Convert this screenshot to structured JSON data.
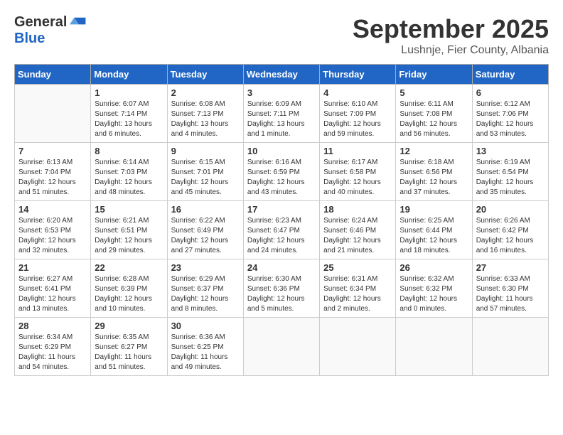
{
  "logo": {
    "general": "General",
    "blue": "Blue"
  },
  "header": {
    "month": "September 2025",
    "location": "Lushnje, Fier County, Albania"
  },
  "weekdays": [
    "Sunday",
    "Monday",
    "Tuesday",
    "Wednesday",
    "Thursday",
    "Friday",
    "Saturday"
  ],
  "weeks": [
    [
      {
        "day": "",
        "info": ""
      },
      {
        "day": "1",
        "info": "Sunrise: 6:07 AM\nSunset: 7:14 PM\nDaylight: 13 hours\nand 6 minutes."
      },
      {
        "day": "2",
        "info": "Sunrise: 6:08 AM\nSunset: 7:13 PM\nDaylight: 13 hours\nand 4 minutes."
      },
      {
        "day": "3",
        "info": "Sunrise: 6:09 AM\nSunset: 7:11 PM\nDaylight: 13 hours\nand 1 minute."
      },
      {
        "day": "4",
        "info": "Sunrise: 6:10 AM\nSunset: 7:09 PM\nDaylight: 12 hours\nand 59 minutes."
      },
      {
        "day": "5",
        "info": "Sunrise: 6:11 AM\nSunset: 7:08 PM\nDaylight: 12 hours\nand 56 minutes."
      },
      {
        "day": "6",
        "info": "Sunrise: 6:12 AM\nSunset: 7:06 PM\nDaylight: 12 hours\nand 53 minutes."
      }
    ],
    [
      {
        "day": "7",
        "info": "Sunrise: 6:13 AM\nSunset: 7:04 PM\nDaylight: 12 hours\nand 51 minutes."
      },
      {
        "day": "8",
        "info": "Sunrise: 6:14 AM\nSunset: 7:03 PM\nDaylight: 12 hours\nand 48 minutes."
      },
      {
        "day": "9",
        "info": "Sunrise: 6:15 AM\nSunset: 7:01 PM\nDaylight: 12 hours\nand 45 minutes."
      },
      {
        "day": "10",
        "info": "Sunrise: 6:16 AM\nSunset: 6:59 PM\nDaylight: 12 hours\nand 43 minutes."
      },
      {
        "day": "11",
        "info": "Sunrise: 6:17 AM\nSunset: 6:58 PM\nDaylight: 12 hours\nand 40 minutes."
      },
      {
        "day": "12",
        "info": "Sunrise: 6:18 AM\nSunset: 6:56 PM\nDaylight: 12 hours\nand 37 minutes."
      },
      {
        "day": "13",
        "info": "Sunrise: 6:19 AM\nSunset: 6:54 PM\nDaylight: 12 hours\nand 35 minutes."
      }
    ],
    [
      {
        "day": "14",
        "info": "Sunrise: 6:20 AM\nSunset: 6:53 PM\nDaylight: 12 hours\nand 32 minutes."
      },
      {
        "day": "15",
        "info": "Sunrise: 6:21 AM\nSunset: 6:51 PM\nDaylight: 12 hours\nand 29 minutes."
      },
      {
        "day": "16",
        "info": "Sunrise: 6:22 AM\nSunset: 6:49 PM\nDaylight: 12 hours\nand 27 minutes."
      },
      {
        "day": "17",
        "info": "Sunrise: 6:23 AM\nSunset: 6:47 PM\nDaylight: 12 hours\nand 24 minutes."
      },
      {
        "day": "18",
        "info": "Sunrise: 6:24 AM\nSunset: 6:46 PM\nDaylight: 12 hours\nand 21 minutes."
      },
      {
        "day": "19",
        "info": "Sunrise: 6:25 AM\nSunset: 6:44 PM\nDaylight: 12 hours\nand 18 minutes."
      },
      {
        "day": "20",
        "info": "Sunrise: 6:26 AM\nSunset: 6:42 PM\nDaylight: 12 hours\nand 16 minutes."
      }
    ],
    [
      {
        "day": "21",
        "info": "Sunrise: 6:27 AM\nSunset: 6:41 PM\nDaylight: 12 hours\nand 13 minutes."
      },
      {
        "day": "22",
        "info": "Sunrise: 6:28 AM\nSunset: 6:39 PM\nDaylight: 12 hours\nand 10 minutes."
      },
      {
        "day": "23",
        "info": "Sunrise: 6:29 AM\nSunset: 6:37 PM\nDaylight: 12 hours\nand 8 minutes."
      },
      {
        "day": "24",
        "info": "Sunrise: 6:30 AM\nSunset: 6:36 PM\nDaylight: 12 hours\nand 5 minutes."
      },
      {
        "day": "25",
        "info": "Sunrise: 6:31 AM\nSunset: 6:34 PM\nDaylight: 12 hours\nand 2 minutes."
      },
      {
        "day": "26",
        "info": "Sunrise: 6:32 AM\nSunset: 6:32 PM\nDaylight: 12 hours\nand 0 minutes."
      },
      {
        "day": "27",
        "info": "Sunrise: 6:33 AM\nSunset: 6:30 PM\nDaylight: 11 hours\nand 57 minutes."
      }
    ],
    [
      {
        "day": "28",
        "info": "Sunrise: 6:34 AM\nSunset: 6:29 PM\nDaylight: 11 hours\nand 54 minutes."
      },
      {
        "day": "29",
        "info": "Sunrise: 6:35 AM\nSunset: 6:27 PM\nDaylight: 11 hours\nand 51 minutes."
      },
      {
        "day": "30",
        "info": "Sunrise: 6:36 AM\nSunset: 6:25 PM\nDaylight: 11 hours\nand 49 minutes."
      },
      {
        "day": "",
        "info": ""
      },
      {
        "day": "",
        "info": ""
      },
      {
        "day": "",
        "info": ""
      },
      {
        "day": "",
        "info": ""
      }
    ]
  ]
}
